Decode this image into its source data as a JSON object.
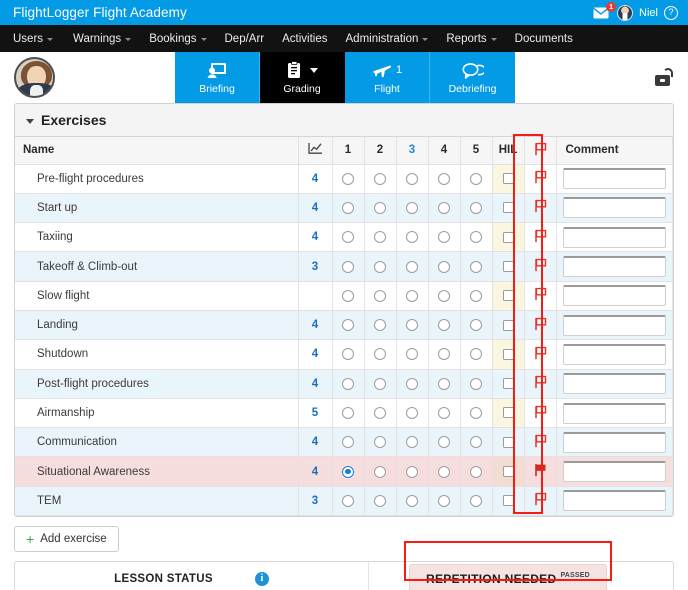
{
  "brand": {
    "title": "FlightLogger Flight Academy",
    "mail_icon": "envelope-icon",
    "mail_badge": "1",
    "user_name": "Niel",
    "help_icon": "?",
    "accent_color": "#039be5"
  },
  "nav": {
    "items": [
      {
        "label": "Users",
        "has_caret": true
      },
      {
        "label": "Warnings",
        "has_caret": true
      },
      {
        "label": "Bookings",
        "has_caret": true
      },
      {
        "label": "Dep/Arr",
        "has_caret": false
      },
      {
        "label": "Activities",
        "has_caret": false
      },
      {
        "label": "Administration",
        "has_caret": true
      },
      {
        "label": "Reports",
        "has_caret": false
      },
      {
        "label": "Documents",
        "has_caret": false
      }
    ]
  },
  "tabs": [
    {
      "label": "Briefing",
      "icon": "presentation-person-icon",
      "active": false,
      "badge": ""
    },
    {
      "label": "Grading",
      "icon": "clipboard-icon",
      "active": true,
      "badge": ""
    },
    {
      "label": "Flight",
      "icon": "airplane-icon",
      "active": false,
      "badge": "1"
    },
    {
      "label": "Debriefing",
      "icon": "speech-bubbles-icon",
      "active": false,
      "badge": ""
    }
  ],
  "lock_icon": "unlock-icon",
  "panel": {
    "title": "Exercises",
    "columns": {
      "name": "Name",
      "chart": "chart-line-icon",
      "scores": [
        "1",
        "2",
        "3",
        "4",
        "5"
      ],
      "highlighted_score": "3",
      "hil": "HIL",
      "flag": "flag-icon",
      "comment": "Comment"
    },
    "rows": [
      {
        "name": "Pre-flight procedures",
        "score": "4",
        "selected": null,
        "hil": false,
        "flagged": false,
        "comment": "",
        "highlight": false
      },
      {
        "name": "Start up",
        "score": "4",
        "selected": null,
        "hil": false,
        "flagged": false,
        "comment": "",
        "highlight": false
      },
      {
        "name": "Taxiing",
        "score": "4",
        "selected": null,
        "hil": false,
        "flagged": false,
        "comment": "",
        "highlight": false
      },
      {
        "name": "Takeoff & Climb-out",
        "score": "3",
        "selected": null,
        "hil": false,
        "flagged": false,
        "comment": "",
        "highlight": false
      },
      {
        "name": "Slow flight",
        "score": "",
        "selected": null,
        "hil": false,
        "flagged": false,
        "comment": "",
        "highlight": false
      },
      {
        "name": "Landing",
        "score": "4",
        "selected": null,
        "hil": false,
        "flagged": false,
        "comment": "",
        "highlight": false
      },
      {
        "name": "Shutdown",
        "score": "4",
        "selected": null,
        "hil": false,
        "flagged": false,
        "comment": "",
        "highlight": false
      },
      {
        "name": "Post-flight procedures",
        "score": "4",
        "selected": null,
        "hil": false,
        "flagged": false,
        "comment": "",
        "highlight": false
      },
      {
        "name": "Airmanship",
        "score": "5",
        "selected": null,
        "hil": false,
        "flagged": false,
        "comment": "",
        "highlight": false
      },
      {
        "name": "Communication",
        "score": "4",
        "selected": null,
        "hil": false,
        "flagged": false,
        "comment": "",
        "highlight": false
      },
      {
        "name": "Situational Awareness",
        "score": "4",
        "selected": 1,
        "hil": false,
        "flagged": true,
        "comment": "",
        "highlight": true
      },
      {
        "name": "TEM",
        "score": "3",
        "selected": null,
        "hil": false,
        "flagged": false,
        "comment": "",
        "highlight": false
      }
    ]
  },
  "footer": {
    "add_exercise_label": "Add exercise",
    "add_icon": "plus-icon",
    "lesson_status_label": "LESSON STATUS",
    "info_icon": "info-icon",
    "repetition_label": "REPETITION NEEDED",
    "repetition_sup": "PASSED"
  },
  "annotations": {
    "flag_column_color": "#f51d13",
    "status_box_color": "#f51d13"
  }
}
